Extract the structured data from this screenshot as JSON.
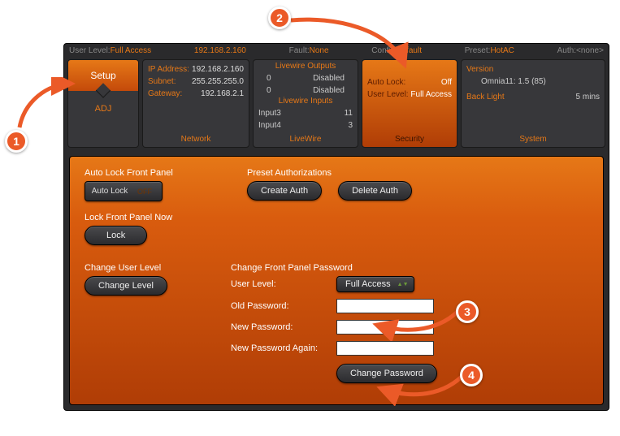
{
  "status": {
    "userlevel_label": "User Level:",
    "userlevel_value": "Full Access",
    "ip": "192.168.2.160",
    "fault_label": "Fault:",
    "fault_value": "None",
    "config_label": "Config:",
    "config_value": "default",
    "preset_label": "Preset:",
    "preset_value": "HotAC",
    "auth_label": "Auth:",
    "auth_value": "<none>"
  },
  "setup_card": {
    "top": "Setup",
    "bottom": "ADJ"
  },
  "network_card": {
    "rows": [
      {
        "k": "IP Address:",
        "v": "192.168.2.160"
      },
      {
        "k": "Subnet:",
        "v": "255.255.255.0"
      },
      {
        "k": "Gateway:",
        "v": "192.168.2.1"
      }
    ],
    "footer": "Network"
  },
  "livewire_card": {
    "outputs_hdr": "Livewire Outputs",
    "outputs": [
      {
        "k": "0",
        "v": "Disabled"
      },
      {
        "k": "0",
        "v": "Disabled"
      }
    ],
    "inputs_hdr": "Livewire Inputs",
    "inputs": [
      {
        "k": "Input3",
        "v": "11"
      },
      {
        "k": "Input4",
        "v": "3"
      }
    ],
    "footer": "LiveWire"
  },
  "security_card": {
    "rows": [
      {
        "k": "Auto Lock:",
        "v": "Off"
      },
      {
        "k": "User Level:",
        "v": "Full Access"
      }
    ],
    "footer": "Security"
  },
  "system_card": {
    "rows": [
      {
        "k": "Version",
        "v": ""
      },
      {
        "k": "",
        "v": "Omnia11: 1.5 (85)"
      },
      {
        "k": "Back Light",
        "v": "5 mins"
      }
    ],
    "footer": "System"
  },
  "panel": {
    "autolock_label": "Auto Lock Front Panel",
    "autolock_button": "Auto Lock",
    "autolock_state": "OFF",
    "presetauth_label": "Preset Authorizations",
    "create_auth": "Create Auth",
    "delete_auth": "Delete Auth",
    "locknow_label": "Lock Front Panel Now",
    "lock_button": "Lock",
    "changelevel_label": "Change User Level",
    "changelevel_button": "Change Level",
    "changepw_label": "Change Front Panel Password",
    "userlevel_field": "User Level:",
    "userlevel_select": "Full Access",
    "oldpw_field": "Old Password:",
    "newpw_field": "New Password:",
    "newpw2_field": "New Password Again:",
    "changepw_button": "Change Password"
  },
  "callouts": {
    "c1": "1",
    "c2": "2",
    "c3": "3",
    "c4": "4"
  }
}
